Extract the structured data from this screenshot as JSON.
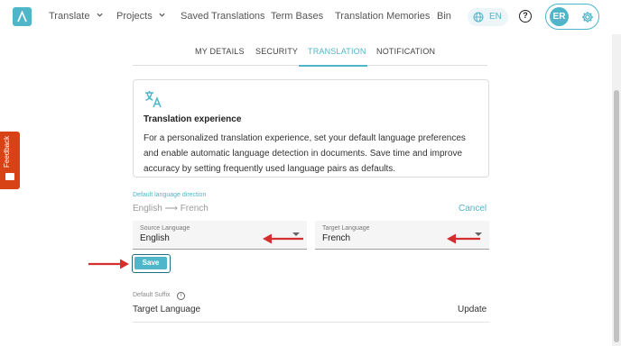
{
  "nav": {
    "items": [
      {
        "label": "Translate",
        "has_dropdown": true
      },
      {
        "label": "Projects",
        "has_dropdown": true
      },
      {
        "label": "Saved Translations"
      },
      {
        "label": "Term Bases"
      },
      {
        "label": "Translation Memories"
      },
      {
        "label": "Bin"
      }
    ],
    "language": "EN",
    "help": "?",
    "user_initials": "ER",
    "icons": [
      "logo-icon",
      "globe-icon",
      "help-icon",
      "gear-icon"
    ]
  },
  "tabs": [
    {
      "label": "MY DETAILS",
      "active": false
    },
    {
      "label": "SECURITY",
      "active": false
    },
    {
      "label": "TRANSLATION",
      "active": true
    },
    {
      "label": "NOTIFICATION",
      "active": false
    }
  ],
  "card": {
    "icon": "translate-icon",
    "title": "Translation experience",
    "text": "For a personalized translation experience, set your default language preferences and enable automatic language detection in documents. Save time and improve accuracy by setting frequently used language pairs as defaults."
  },
  "direction": {
    "label": "Default language direction",
    "value": "English ⟶ French",
    "cancel": "Cancel"
  },
  "source": {
    "label": "Source Language",
    "value": "English"
  },
  "target": {
    "label": "Target Language",
    "value": "French"
  },
  "save": "Save",
  "suffix": {
    "label": "Default Suffix",
    "value": "Target Language",
    "action": "Update"
  },
  "feedback": "Feedback",
  "colors": {
    "accent": "#4fb6c9",
    "arrow": "#d32f2f",
    "feedback": "#d84315"
  }
}
